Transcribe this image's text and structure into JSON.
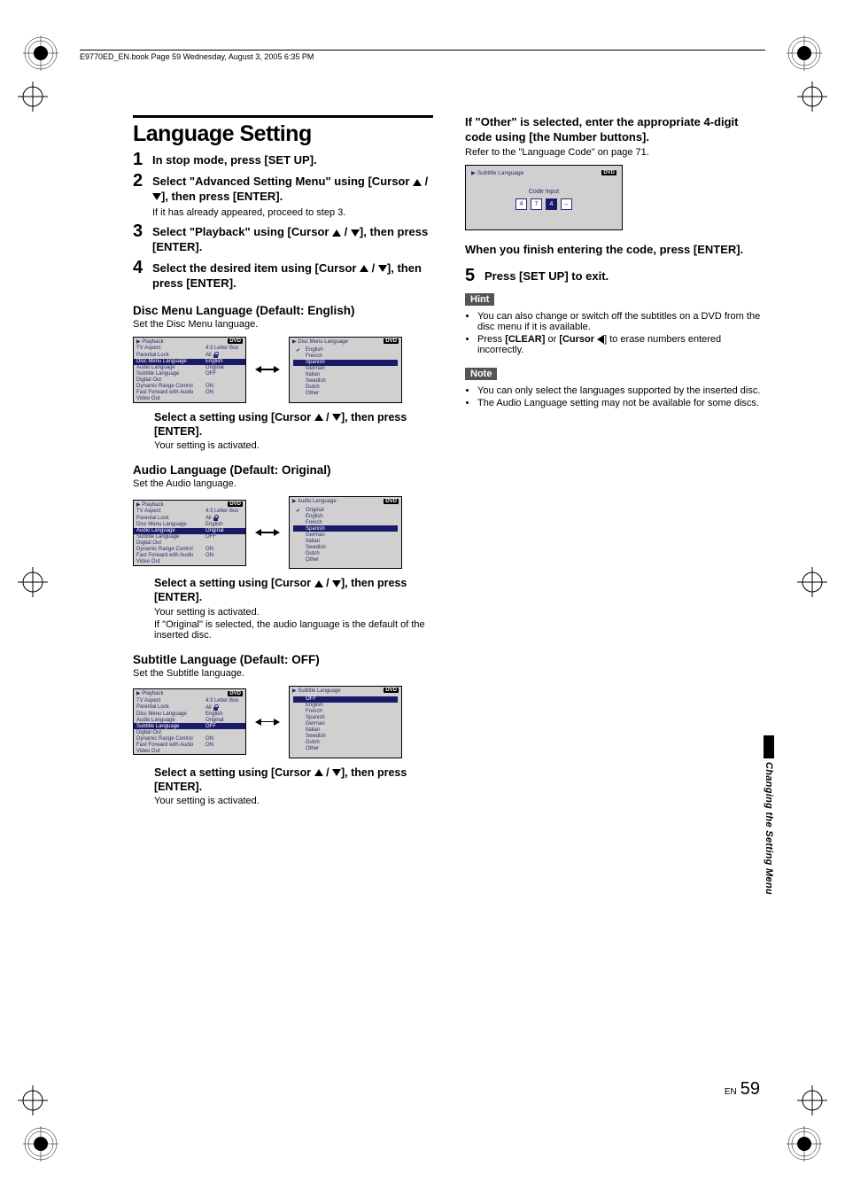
{
  "header": {
    "meta": "E9770ED_EN.book  Page 59  Wednesday, August 3, 2005  6:35 PM"
  },
  "title": "Language Setting",
  "steps": [
    {
      "num": "1",
      "text_before": "In stop mode, press [SET UP]."
    },
    {
      "num": "2",
      "text_before": "Select \"Advanced Setting Menu\" using [Cursor ",
      "text_after": "], then press [ENTER].",
      "sub": "If it has already appeared, proceed to step 3."
    },
    {
      "num": "3",
      "text_before": "Select \"Playback\" using [Cursor ",
      "text_after": "], then press [ENTER]."
    },
    {
      "num": "4",
      "text_before": "Select the desired item using [Cursor ",
      "text_after": "], then press [ENTER]."
    }
  ],
  "disc_menu": {
    "heading": "Disc Menu Language (Default: English)",
    "desc": "Set the Disc Menu language.",
    "left_title": "Playback",
    "rows": [
      {
        "k": "TV Aspect",
        "v": "4:3 Letter Box"
      },
      {
        "k": "Parental Lock",
        "v": "All",
        "lock": true
      },
      {
        "k": "Disc Menu Language",
        "v": "English",
        "hi": true
      },
      {
        "k": "Audio Language",
        "v": "Original"
      },
      {
        "k": "Subtitle Language",
        "v": "OFF"
      },
      {
        "k": "Digital Out",
        "v": ""
      },
      {
        "k": "Dynamic Range Control",
        "v": "ON"
      },
      {
        "k": "Fast Forward with Audio",
        "v": "ON"
      },
      {
        "k": "Video Out",
        "v": ""
      }
    ],
    "right_title": "Disc Menu Language",
    "options": [
      {
        "t": "English",
        "chk": true
      },
      {
        "t": "French"
      },
      {
        "t": "Spanish",
        "hi": true
      },
      {
        "t": "German"
      },
      {
        "t": "Italian"
      },
      {
        "t": "Swedish"
      },
      {
        "t": "Dutch"
      },
      {
        "t": "Other"
      }
    ],
    "sel_lead_before": "Select a setting using [Cursor ",
    "sel_lead_after": "], then press [ENTER].",
    "sel_after": "Your setting is activated."
  },
  "audio": {
    "heading": "Audio Language (Default: Original)",
    "desc": "Set the Audio language.",
    "left_title": "Playback",
    "rows": [
      {
        "k": "TV Aspect",
        "v": "4:3 Letter Box"
      },
      {
        "k": "Parental Lock",
        "v": "All",
        "lock": true
      },
      {
        "k": "Disc Menu Language",
        "v": "English"
      },
      {
        "k": "Audio Language",
        "v": "Original",
        "hi": true
      },
      {
        "k": "Subtitle Language",
        "v": "OFF"
      },
      {
        "k": "Digital Out",
        "v": ""
      },
      {
        "k": "Dynamic Range Control",
        "v": "ON"
      },
      {
        "k": "Fast Forward with Audio",
        "v": "ON"
      },
      {
        "k": "Video Out",
        "v": ""
      }
    ],
    "right_title": "Audio Language",
    "options": [
      {
        "t": "Original",
        "chk": true
      },
      {
        "t": "English"
      },
      {
        "t": "French"
      },
      {
        "t": "Spanish",
        "hi": true
      },
      {
        "t": "German"
      },
      {
        "t": "Italian"
      },
      {
        "t": "Swedish"
      },
      {
        "t": "Dutch"
      },
      {
        "t": "Other"
      }
    ],
    "sel_lead_before": "Select a setting using [Cursor ",
    "sel_lead_after": "], then press [ENTER].",
    "sel_after1": "Your setting is activated.",
    "sel_after2": "If \"Original\" is selected, the audio language is the default of the inserted disc."
  },
  "subtitle": {
    "heading": "Subtitle Language (Default: OFF)",
    "desc": "Set the Subtitle language.",
    "left_title": "Playback",
    "rows": [
      {
        "k": "TV Aspect",
        "v": "4:3 Letter Box"
      },
      {
        "k": "Parental Lock",
        "v": "All",
        "lock": true
      },
      {
        "k": "Disc Menu Language",
        "v": "English"
      },
      {
        "k": "Audio Language",
        "v": "Original"
      },
      {
        "k": "Subtitle Language",
        "v": "OFF",
        "hi": true
      },
      {
        "k": "Digital Out",
        "v": ""
      },
      {
        "k": "Dynamic Range Control",
        "v": "ON"
      },
      {
        "k": "Fast Forward with Audio",
        "v": "ON"
      },
      {
        "k": "Video Out",
        "v": ""
      }
    ],
    "right_title": "Subtitle Language",
    "options": [
      {
        "t": "OFF",
        "chk": true,
        "hi": true
      },
      {
        "t": "English"
      },
      {
        "t": "French"
      },
      {
        "t": "Spanish"
      },
      {
        "t": "German"
      },
      {
        "t": "Italian"
      },
      {
        "t": "Swedish"
      },
      {
        "t": "Dutch"
      },
      {
        "t": "Other"
      }
    ],
    "sel_lead_before": "Select a setting using [Cursor ",
    "sel_lead_after": "], then press [ENTER].",
    "sel_after": "Your setting is activated."
  },
  "right": {
    "other_head": "If \"Other\" is selected, enter the appropriate 4-digit code using [the Number buttons].",
    "other_sub": "Refer to the \"Language Code\" on page 71.",
    "code_title": "Subtitle Language",
    "code_label": "Code Input",
    "digits": [
      "4",
      "7",
      "4",
      "–"
    ],
    "finish": "When you finish entering the code, press [ENTER].",
    "step5_num": "5",
    "step5_text": "Press [SET UP] to exit.",
    "hint_tag": "Hint",
    "hints": [
      "You can also change or switch off the subtitles on a DVD from the disc menu if it is available."
    ],
    "hint2_before": "Press ",
    "hint2_b1": "[CLEAR]",
    "hint2_mid": " or ",
    "hint2_b2": "[Cursor ",
    "hint2_after": "] to erase numbers entered incorrectly.",
    "note_tag": "Note",
    "notes": [
      "You can only select the languages supported by the inserted disc.",
      "The Audio Language setting may not be available for some discs."
    ]
  },
  "side_label": "Changing the Setting Menu",
  "page_en": "EN",
  "page_num": "59",
  "dvd_badge": "DVD"
}
